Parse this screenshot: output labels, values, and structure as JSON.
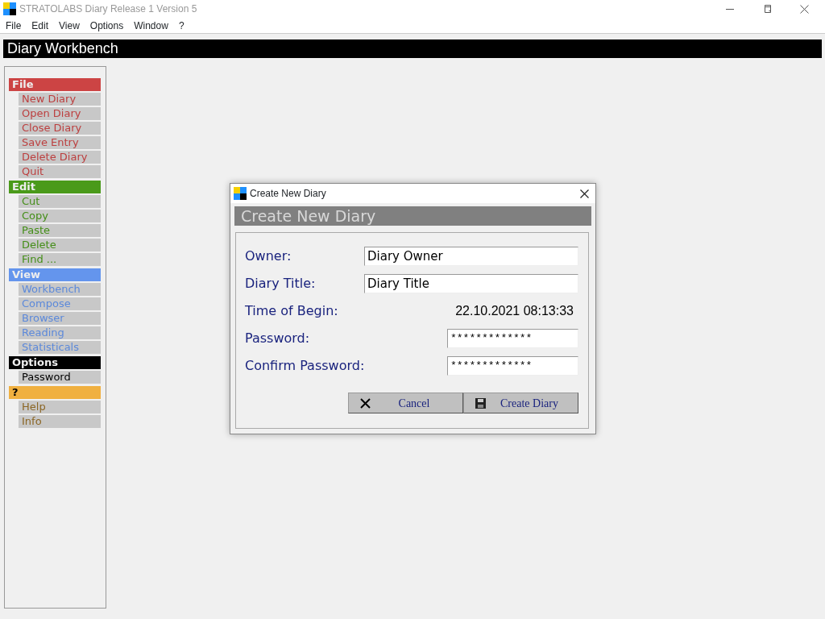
{
  "window": {
    "title": "STRATOLABS Diary Release 1 Version 5"
  },
  "menu": [
    "File",
    "Edit",
    "View",
    "Options",
    "Window",
    "?"
  ],
  "header": "Diary Workbench",
  "sidebar": [
    {
      "label": "File",
      "color": "#cc4444",
      "items": [
        "New Diary",
        "Open Diary",
        "Close Diary",
        "Save Entry",
        "Delete Diary",
        "Quit"
      ]
    },
    {
      "label": "Edit",
      "color": "#4a9a1a",
      "items": [
        "Cut",
        "Copy",
        "Paste",
        "Delete",
        "Find ..."
      ]
    },
    {
      "label": "View",
      "color": "#6495ed",
      "items": [
        "Workbench",
        "Compose",
        "Browser",
        "Reading",
        "Statisticals"
      ]
    },
    {
      "label": "Options",
      "color": "#000000",
      "items": [
        "Password"
      ]
    },
    {
      "label": "?",
      "color": "#f0b040",
      "items": [
        "Help",
        "Info"
      ]
    }
  ],
  "dialog": {
    "title": "Create New Diary",
    "heading": "Create New Diary",
    "fields": [
      {
        "kind": "text",
        "label": "Owner:",
        "value": "Diary Owner"
      },
      {
        "kind": "text",
        "label": "Diary Title:",
        "value": "Diary Title"
      },
      {
        "kind": "static",
        "label": "Time of Begin:",
        "value": "22.10.2021 08:13:33"
      },
      {
        "kind": "password",
        "label": "Password:",
        "value": "*************"
      },
      {
        "kind": "password",
        "label": "Confirm Password:",
        "value": "*************"
      }
    ],
    "buttons": [
      {
        "kind": "cancel",
        "label": "Cancel"
      },
      {
        "kind": "save",
        "label": "Create Diary"
      }
    ]
  }
}
